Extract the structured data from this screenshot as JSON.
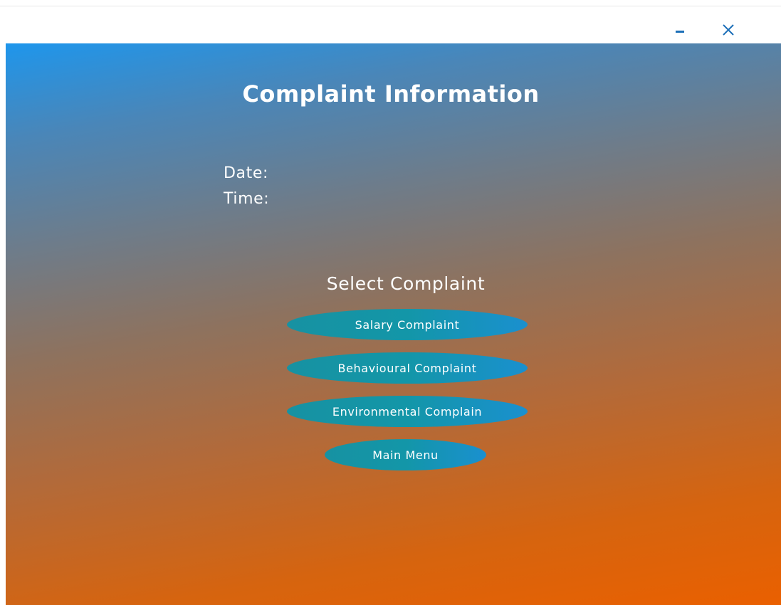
{
  "window": {
    "minimize_glyph": "minimize-icon",
    "close_glyph": "close-icon"
  },
  "form": {
    "title": "Complaint Information",
    "date_label": "Date:",
    "time_label": "Time:",
    "select_heading": "Select Complaint"
  },
  "buttons": {
    "salary": "Salary Complaint",
    "behavioural": "Behavioural Complaint",
    "environmental": "Environmental Complain",
    "main_menu": "Main Menu"
  },
  "colors": {
    "gradient_top": "#1e96ec",
    "gradient_bottom": "#ea6000",
    "button_fill": "#1396a8",
    "window_controls": "#1c6fb8"
  }
}
